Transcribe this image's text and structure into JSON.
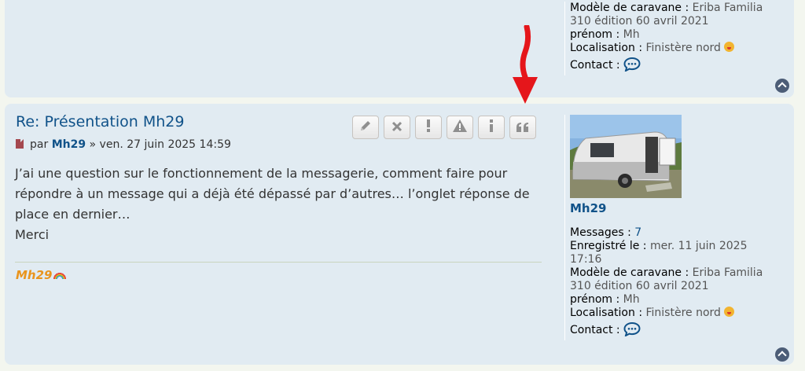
{
  "top_post": {
    "profile": {
      "model_key": "Modèle de caravane :",
      "model_value": "Eriba Familia 310 édition 60 avril 2021",
      "firstname_key": "prénom :",
      "firstname_value": "Mh",
      "location_key": "Localisation :",
      "location_value": "Finistère nord",
      "contact_key": "Contact :"
    }
  },
  "post": {
    "title": "Re: Présentation Mh29",
    "meta_par": "par",
    "author": "Mh29",
    "meta_date": "» ven. 27 juin 2025 14:59",
    "buttons": [
      {
        "name": "edit",
        "icon": "pencil-icon"
      },
      {
        "name": "delete",
        "icon": "close-icon"
      },
      {
        "name": "warn",
        "icon": "exclamation-icon"
      },
      {
        "name": "report",
        "icon": "warning-triangle-icon"
      },
      {
        "name": "info",
        "icon": "info-icon"
      },
      {
        "name": "quote",
        "icon": "quote-icon"
      }
    ],
    "content": [
      "J’ai une question sur le fonctionnement de la messagerie, comment faire pour répondre à un message qui a déjà été dépassé par d’autres… l’onglet réponse de place en dernier…",
      "Merci"
    ],
    "signature": "Mh29",
    "profile": {
      "username": "Mh29",
      "messages_key": "Messages :",
      "messages_value": "7",
      "registered_key": "Enregistré le :",
      "registered_value": "mer. 11 juin 2025 17:16",
      "model_key": "Modèle de caravane :",
      "model_value": "Eriba Familia 310 édition 60 avril 2021",
      "firstname_key": "prénom :",
      "firstname_value": "Mh",
      "location_key": "Localisation :",
      "location_value": "Finistère nord",
      "contact_key": "Contact :"
    }
  },
  "colors": {
    "post_bg": "#e1ebf2",
    "link": "#105289",
    "signature": "#e9941d",
    "annotation_arrow": "#e5161b"
  }
}
